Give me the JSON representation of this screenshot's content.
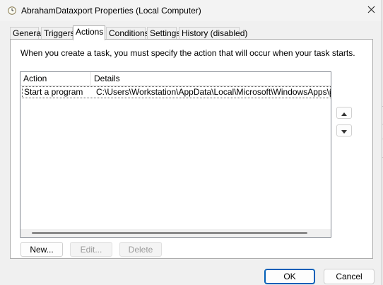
{
  "window": {
    "title": "AbrahamDataxport Properties (Local Computer)",
    "close_glyph": "✕"
  },
  "tabs": [
    {
      "label": "General",
      "active": false
    },
    {
      "label": "Triggers",
      "active": false
    },
    {
      "label": "Actions",
      "active": true
    },
    {
      "label": "Conditions",
      "active": false
    },
    {
      "label": "Settings",
      "active": false
    },
    {
      "label": "History (disabled)",
      "active": false
    }
  ],
  "actions_tab": {
    "intro": "When you create a task, you must specify the action that will occur when your task starts.",
    "columns": [
      "Action",
      "Details"
    ],
    "rows": [
      {
        "action": "Start a program",
        "details": "C:\\Users\\Workstation\\AppData\\Local\\Microsoft\\WindowsApps\\python.exe"
      }
    ],
    "buttons": {
      "new": "New...",
      "edit": "Edit...",
      "delete": "Delete"
    },
    "move_up_glyph": "▲",
    "move_down_glyph": "▼"
  },
  "footer": {
    "ok": "OK",
    "cancel": "Cancel"
  },
  "colors": {
    "accent": "#005fb8",
    "disabled_text": "#9a9a9a"
  },
  "icons": {
    "title": "clock-icon",
    "close": "close-icon",
    "up": "arrow-up-icon",
    "down": "arrow-down-icon"
  }
}
